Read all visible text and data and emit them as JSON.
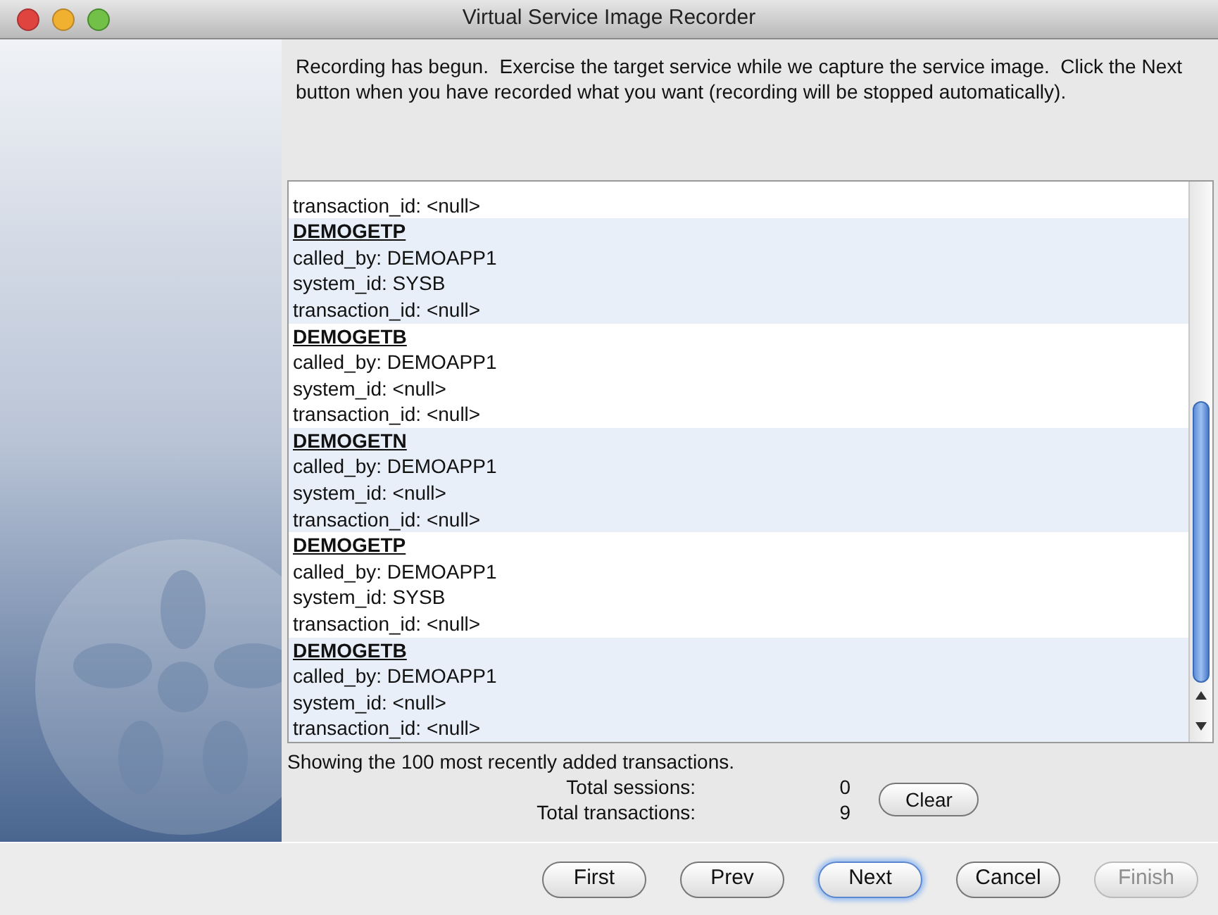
{
  "window": {
    "title": "Virtual Service Image Recorder"
  },
  "instructions": "Recording has begun.  Exercise the target service while we capture the service image.  Click the Next button when you have recorded what you want (recording will be stopped automatically).",
  "transactions": [
    {
      "lines": [
        "transaction_id: <null>"
      ]
    },
    {
      "name": "DEMOGETP",
      "lines": [
        "called_by: DEMOAPP1",
        "system_id: SYSB",
        "transaction_id: <null>"
      ]
    },
    {
      "name": "DEMOGETB",
      "lines": [
        "called_by: DEMOAPP1",
        "system_id: <null>",
        "transaction_id: <null>"
      ]
    },
    {
      "name": "DEMOGETN",
      "lines": [
        "called_by: DEMOAPP1",
        "system_id: <null>",
        "transaction_id: <null>"
      ]
    },
    {
      "name": "DEMOGETP",
      "lines": [
        "called_by: DEMOAPP1",
        "system_id: SYSB",
        "transaction_id: <null>"
      ]
    },
    {
      "name": "DEMOGETB",
      "lines": [
        "called_by: DEMOAPP1",
        "system_id: <null>",
        "transaction_id: <null>"
      ]
    }
  ],
  "status": "Showing the 100 most recently added transactions.",
  "totals": [
    {
      "label": "Total sessions:",
      "value": "0"
    },
    {
      "label": "Total transactions:",
      "value": "9"
    }
  ],
  "clear_button": "Clear",
  "buttons": [
    {
      "label": "First",
      "default": false,
      "disabled": false
    },
    {
      "label": "Prev",
      "default": false,
      "disabled": false
    },
    {
      "label": "Next",
      "default": true,
      "disabled": false
    },
    {
      "label": "Cancel",
      "default": false,
      "disabled": false
    },
    {
      "label": "Finish",
      "default": false,
      "disabled": true
    }
  ]
}
